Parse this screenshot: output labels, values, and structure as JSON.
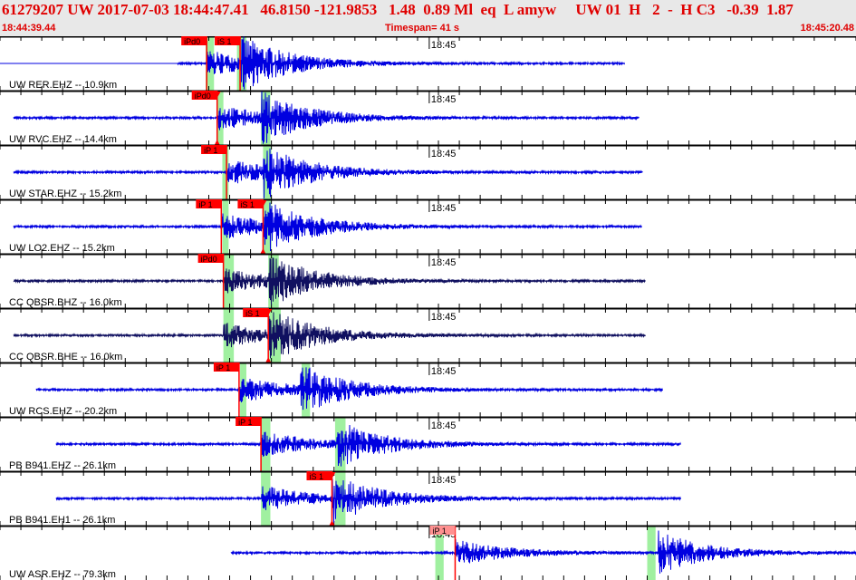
{
  "header": {
    "title": "61279207 UW 2017-07-03 18:44:47.41   46.8150 -121.9853   1.48  0.89 Ml  eq  L amyw     UW 01  H   2  -  H C3   -0.39  1.87",
    "start_time": "18:44:39.44",
    "timespan": "Timespan=  41 s",
    "end_time": "18:45:20.48"
  },
  "timespan_s": 41,
  "minute_label": "18:45",
  "minute_offset_s": 20.56,
  "colors": {
    "trace": "#0000e0",
    "trace_bb": "#101060",
    "pick": "#ff0000",
    "pick_faint": "#ff9090",
    "window": "#a0f0a0",
    "text": "#e00000"
  },
  "traces": [
    {
      "label": "UW RER.EHZ -- 10.9km",
      "start": 0,
      "end": 29.9,
      "p": 9.9,
      "s": 11.5,
      "bb": false,
      "picks": [
        {
          "text": "iPd0",
          "t": 9.9,
          "pos": "top"
        },
        {
          "text": "iS 1",
          "t": 11.5,
          "pos": "top"
        }
      ],
      "windows": [
        [
          9.85,
          10.25
        ],
        [
          11.35,
          11.8
        ]
      ]
    },
    {
      "label": "UW RVC.EHZ -- 14.4km",
      "start": 0.65,
      "end": 30.6,
      "p": 10.4,
      "s": 12.5,
      "bb": false,
      "picks": [
        {
          "text": "iPd0",
          "t": 10.4,
          "pos": "top",
          "tri": true
        }
      ],
      "windows": [
        [
          10.4,
          10.7
        ],
        [
          12.5,
          12.95
        ]
      ]
    },
    {
      "label": "UW STAR.EHZ -- 15.2km",
      "start": 0.65,
      "end": 30.75,
      "p": 10.85,
      "s": 12.6,
      "bb": false,
      "picks": [
        {
          "text": "iP 1",
          "t": 10.85,
          "pos": "top"
        }
      ],
      "windows": [
        [
          10.65,
          10.95
        ],
        [
          12.6,
          13.0
        ]
      ]
    },
    {
      "label": "UW LO2.EHZ -- 15.2km",
      "start": 0.65,
      "end": 30.7,
      "p": 10.6,
      "s": 12.6,
      "bb": false,
      "picks": [
        {
          "text": "iP 1",
          "t": 10.6,
          "pos": "top"
        },
        {
          "text": "iS 1",
          "t": 12.6,
          "pos": "top",
          "tri": true
        }
      ],
      "windows": [
        [
          10.65,
          10.95
        ],
        [
          12.6,
          13.0
        ]
      ]
    },
    {
      "label": "CC QBSR.BHZ -- 16.0km",
      "start": 0.65,
      "end": 30.9,
      "p": 10.7,
      "s": 12.85,
      "bb": true,
      "picks": [
        {
          "text": "iPd0",
          "t": 10.7,
          "pos": "top"
        }
      ],
      "windows": [
        [
          10.7,
          11.2
        ],
        [
          12.85,
          13.35
        ]
      ]
    },
    {
      "label": "CC QBSR.BHE -- 16.0km",
      "start": 0.65,
      "end": 30.9,
      "p": 10.7,
      "s": 12.85,
      "bb": true,
      "picks": [
        {
          "text": "iS 1",
          "t": 12.85,
          "pos": "top",
          "tri": true
        }
      ],
      "windows": [
        [
          10.7,
          11.2
        ],
        [
          12.9,
          13.45
        ]
      ]
    },
    {
      "label": "UW RCS.EHZ -- 20.2km",
      "start": 1.75,
      "end": 31.7,
      "p": 11.45,
      "s": 14.4,
      "bb": false,
      "picks": [
        {
          "text": "iP 1",
          "t": 11.45,
          "pos": "top"
        }
      ],
      "windows": [
        [
          11.5,
          11.8
        ],
        [
          14.45,
          14.85
        ]
      ]
    },
    {
      "label": "PB B941.EHZ -- 26.1km",
      "start": 2.7,
      "end": 32.6,
      "p": 12.5,
      "s": 16.1,
      "bb": false,
      "picks": [
        {
          "text": "iP 1",
          "t": 12.5,
          "pos": "top"
        }
      ],
      "windows": [
        [
          12.5,
          12.95
        ],
        [
          16.05,
          16.55
        ]
      ]
    },
    {
      "label": "PB B941.EH1 -- 26.1km",
      "start": 2.7,
      "end": 32.6,
      "p": 12.5,
      "s": 15.9,
      "bb": false,
      "picks": [
        {
          "text": "iS 1",
          "t": 15.9,
          "pos": "top",
          "tri": true
        }
      ],
      "windows": [
        [
          12.5,
          12.95
        ],
        [
          16.05,
          16.55
        ]
      ]
    },
    {
      "label": "UW ASR.EHZ -- 79.3km",
      "start": 11.05,
      "end": 41,
      "p": 21.8,
      "s": 31.5,
      "bb": false,
      "faint": true,
      "picks": [
        {
          "text": "iP 1",
          "t": 21.8,
          "pos": "top"
        }
      ],
      "windows": [
        [
          20.85,
          21.25
        ],
        [
          31.0,
          31.4
        ]
      ]
    }
  ]
}
